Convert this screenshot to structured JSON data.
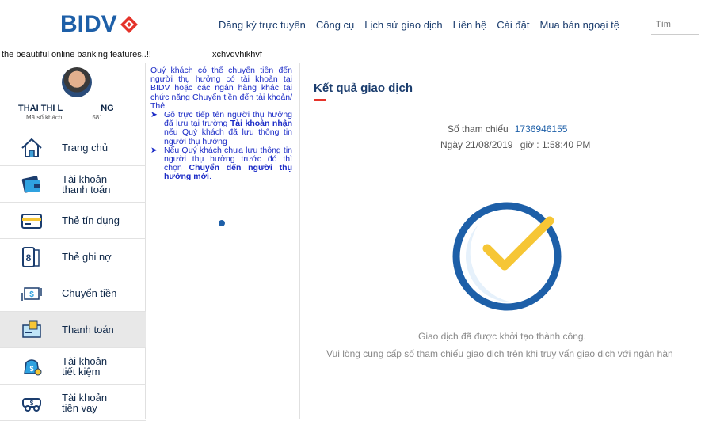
{
  "header": {
    "logo_text": "BIDV",
    "nav": [
      "Đăng ký trực tuyến",
      "Công cụ",
      "Lịch sử giao dịch",
      "Liên hệ",
      "Cài đặt",
      "Mua bán ngoại tệ"
    ],
    "search_placeholder": "Tìm"
  },
  "marquee": {
    "text1": "the beautiful online banking features..!!",
    "text2": "xchvdvhikhvf"
  },
  "profile": {
    "name_left": "THAI THI L",
    "name_right": "NG",
    "id_left": "Mã số khách",
    "id_right": "581"
  },
  "menu": [
    {
      "label1": "Trang chủ",
      "label2": "",
      "icon": "home-icon"
    },
    {
      "label1": "Tài khoản",
      "label2": "thanh toán",
      "icon": "wallet-icon"
    },
    {
      "label1": "Thẻ tín dụng",
      "label2": "",
      "icon": "credit-card-icon"
    },
    {
      "label1": "Thẻ ghi nợ",
      "label2": "",
      "icon": "debit-card-icon"
    },
    {
      "label1": "Chuyển tiền",
      "label2": "",
      "icon": "transfer-icon"
    },
    {
      "label1": "Thanh toán",
      "label2": "",
      "icon": "payment-icon"
    },
    {
      "label1": "Tài khoản",
      "label2": "tiết kiệm",
      "icon": "savings-icon"
    },
    {
      "label1": "Tài khoản",
      "label2": "tiền vay",
      "icon": "loan-icon"
    }
  ],
  "info": {
    "intro": "Quý khách có thể chuyển tiền đến người thụ hưởng có tài khoản tại BIDV hoặc các ngân hàng khác tại chức năng Chuyển tiền đến tài khoản/ Thẻ.",
    "b1_pre": "Gõ trực tiếp tên người thụ hưởng đã lưu tại trường ",
    "b1_bold": "Tài khoản nhận",
    "b1_post": " nếu Quý khách đã lưu thông tin người thụ hưởng",
    "b2_pre": "Nếu Quý khách chưa lưu thông tin người thụ hưởng trước đó thì chọn ",
    "b2_bold": "Chuyển đến người thụ hưởng mới",
    "b2_post": "."
  },
  "result": {
    "title": "Kết quả giao dịch",
    "ref_label": "Số tham chiếu",
    "ref_value": "1736946155",
    "date_label": "Ngày",
    "date_value": "21/08/2019",
    "time_label": "giờ :",
    "time_value": "1:58:40 PM",
    "msg1": "Giao dịch đã được khởi tạo thành công.",
    "msg2": "Vui lòng cung cấp số tham chiếu giao dịch trên khi truy vấn giao dịch với ngân hàn"
  },
  "colors": {
    "brand_blue": "#1d5fa8",
    "brand_red": "#e5332a",
    "check_yellow": "#f6c635"
  }
}
